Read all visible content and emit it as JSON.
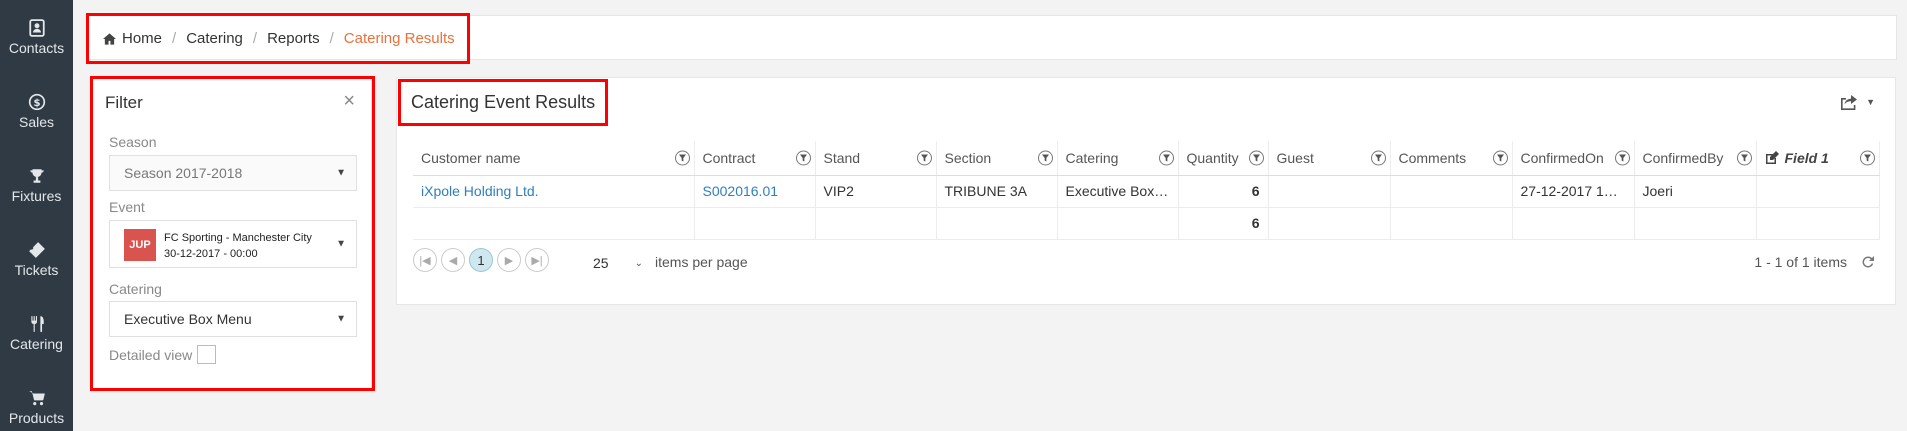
{
  "sidebar": {
    "items": [
      {
        "label": "Contacts",
        "icon": "contacts-icon"
      },
      {
        "label": "Sales",
        "icon": "dollar-icon"
      },
      {
        "label": "Fixtures",
        "icon": "trophy-icon"
      },
      {
        "label": "Tickets",
        "icon": "ticket-icon"
      },
      {
        "label": "Catering",
        "icon": "cutlery-icon"
      },
      {
        "label": "Products",
        "icon": "cart-icon"
      }
    ]
  },
  "breadcrumb": {
    "items": [
      "Home",
      "Catering",
      "Reports"
    ],
    "active": "Catering Results"
  },
  "filter": {
    "title": "Filter",
    "close": "×",
    "season_label": "Season",
    "season_value": "Season 2017-2018",
    "event_label": "Event",
    "event_badge": "JUP",
    "event_name": "FC Sporting - Manchester City",
    "event_date": "30-12-2017 - 00:00",
    "catering_label": "Catering",
    "catering_value": "Executive Box Menu",
    "detailed_label": "Detailed view"
  },
  "results": {
    "title": "Catering Event Results",
    "columns": [
      "Customer name",
      "Contract",
      "Stand",
      "Section",
      "Catering",
      "Quantity",
      "Guest",
      "Comments",
      "ConfirmedOn",
      "ConfirmedBy",
      "Field 1"
    ],
    "rows": [
      [
        "iXpole Holding Ltd.",
        "S002016.01",
        "VIP2",
        "TRIBUNE 3A",
        "Executive Box ...",
        "6",
        "",
        "",
        "27-12-2017 14:...",
        "Joeri",
        ""
      ]
    ],
    "totals": [
      "",
      "",
      "",
      "",
      "",
      "6",
      "",
      "",
      "",
      "",
      ""
    ],
    "pager": {
      "current_page": "1",
      "page_size": "25",
      "items_per_page_label": "items per page",
      "info": "1 - 1 of 1 items"
    }
  }
}
